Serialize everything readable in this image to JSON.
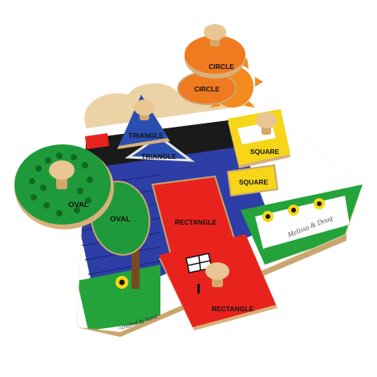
{
  "image": {
    "subject": "Wooden shape puzzle with knobbed pieces",
    "colors": {
      "wood": "#ecd3a6",
      "wood_edge": "#c9a66e",
      "sky": "#ffffff",
      "house_blue": "#2d3ea6",
      "roof_black": "#1a1a1a",
      "grass": "#24a33a",
      "oval_green": "#1f9a3b",
      "circle_orange": "#f07a1f",
      "triangle_blue": "#2b4fb0",
      "square_yellow": "#f7d61a",
      "rectangle_red": "#e8231d",
      "sun_orange": "#f28a1e"
    }
  },
  "labels": {
    "circle_piece": "CIRCLE",
    "circle_slot": "CIRCLE",
    "triangle_piece": "TRIANGLE",
    "triangle_slot": "TRIANGLE",
    "square_piece": "SQUARE",
    "square_slot": "SQUARE",
    "oval_piece": "OVAL",
    "oval_slot": "OVAL",
    "rectangle_piece": "RECTANGLE",
    "rectangle_slot": "RECTANGLE",
    "brand": "Melissa & Doug",
    "crafted": "~crafted by hand~"
  }
}
